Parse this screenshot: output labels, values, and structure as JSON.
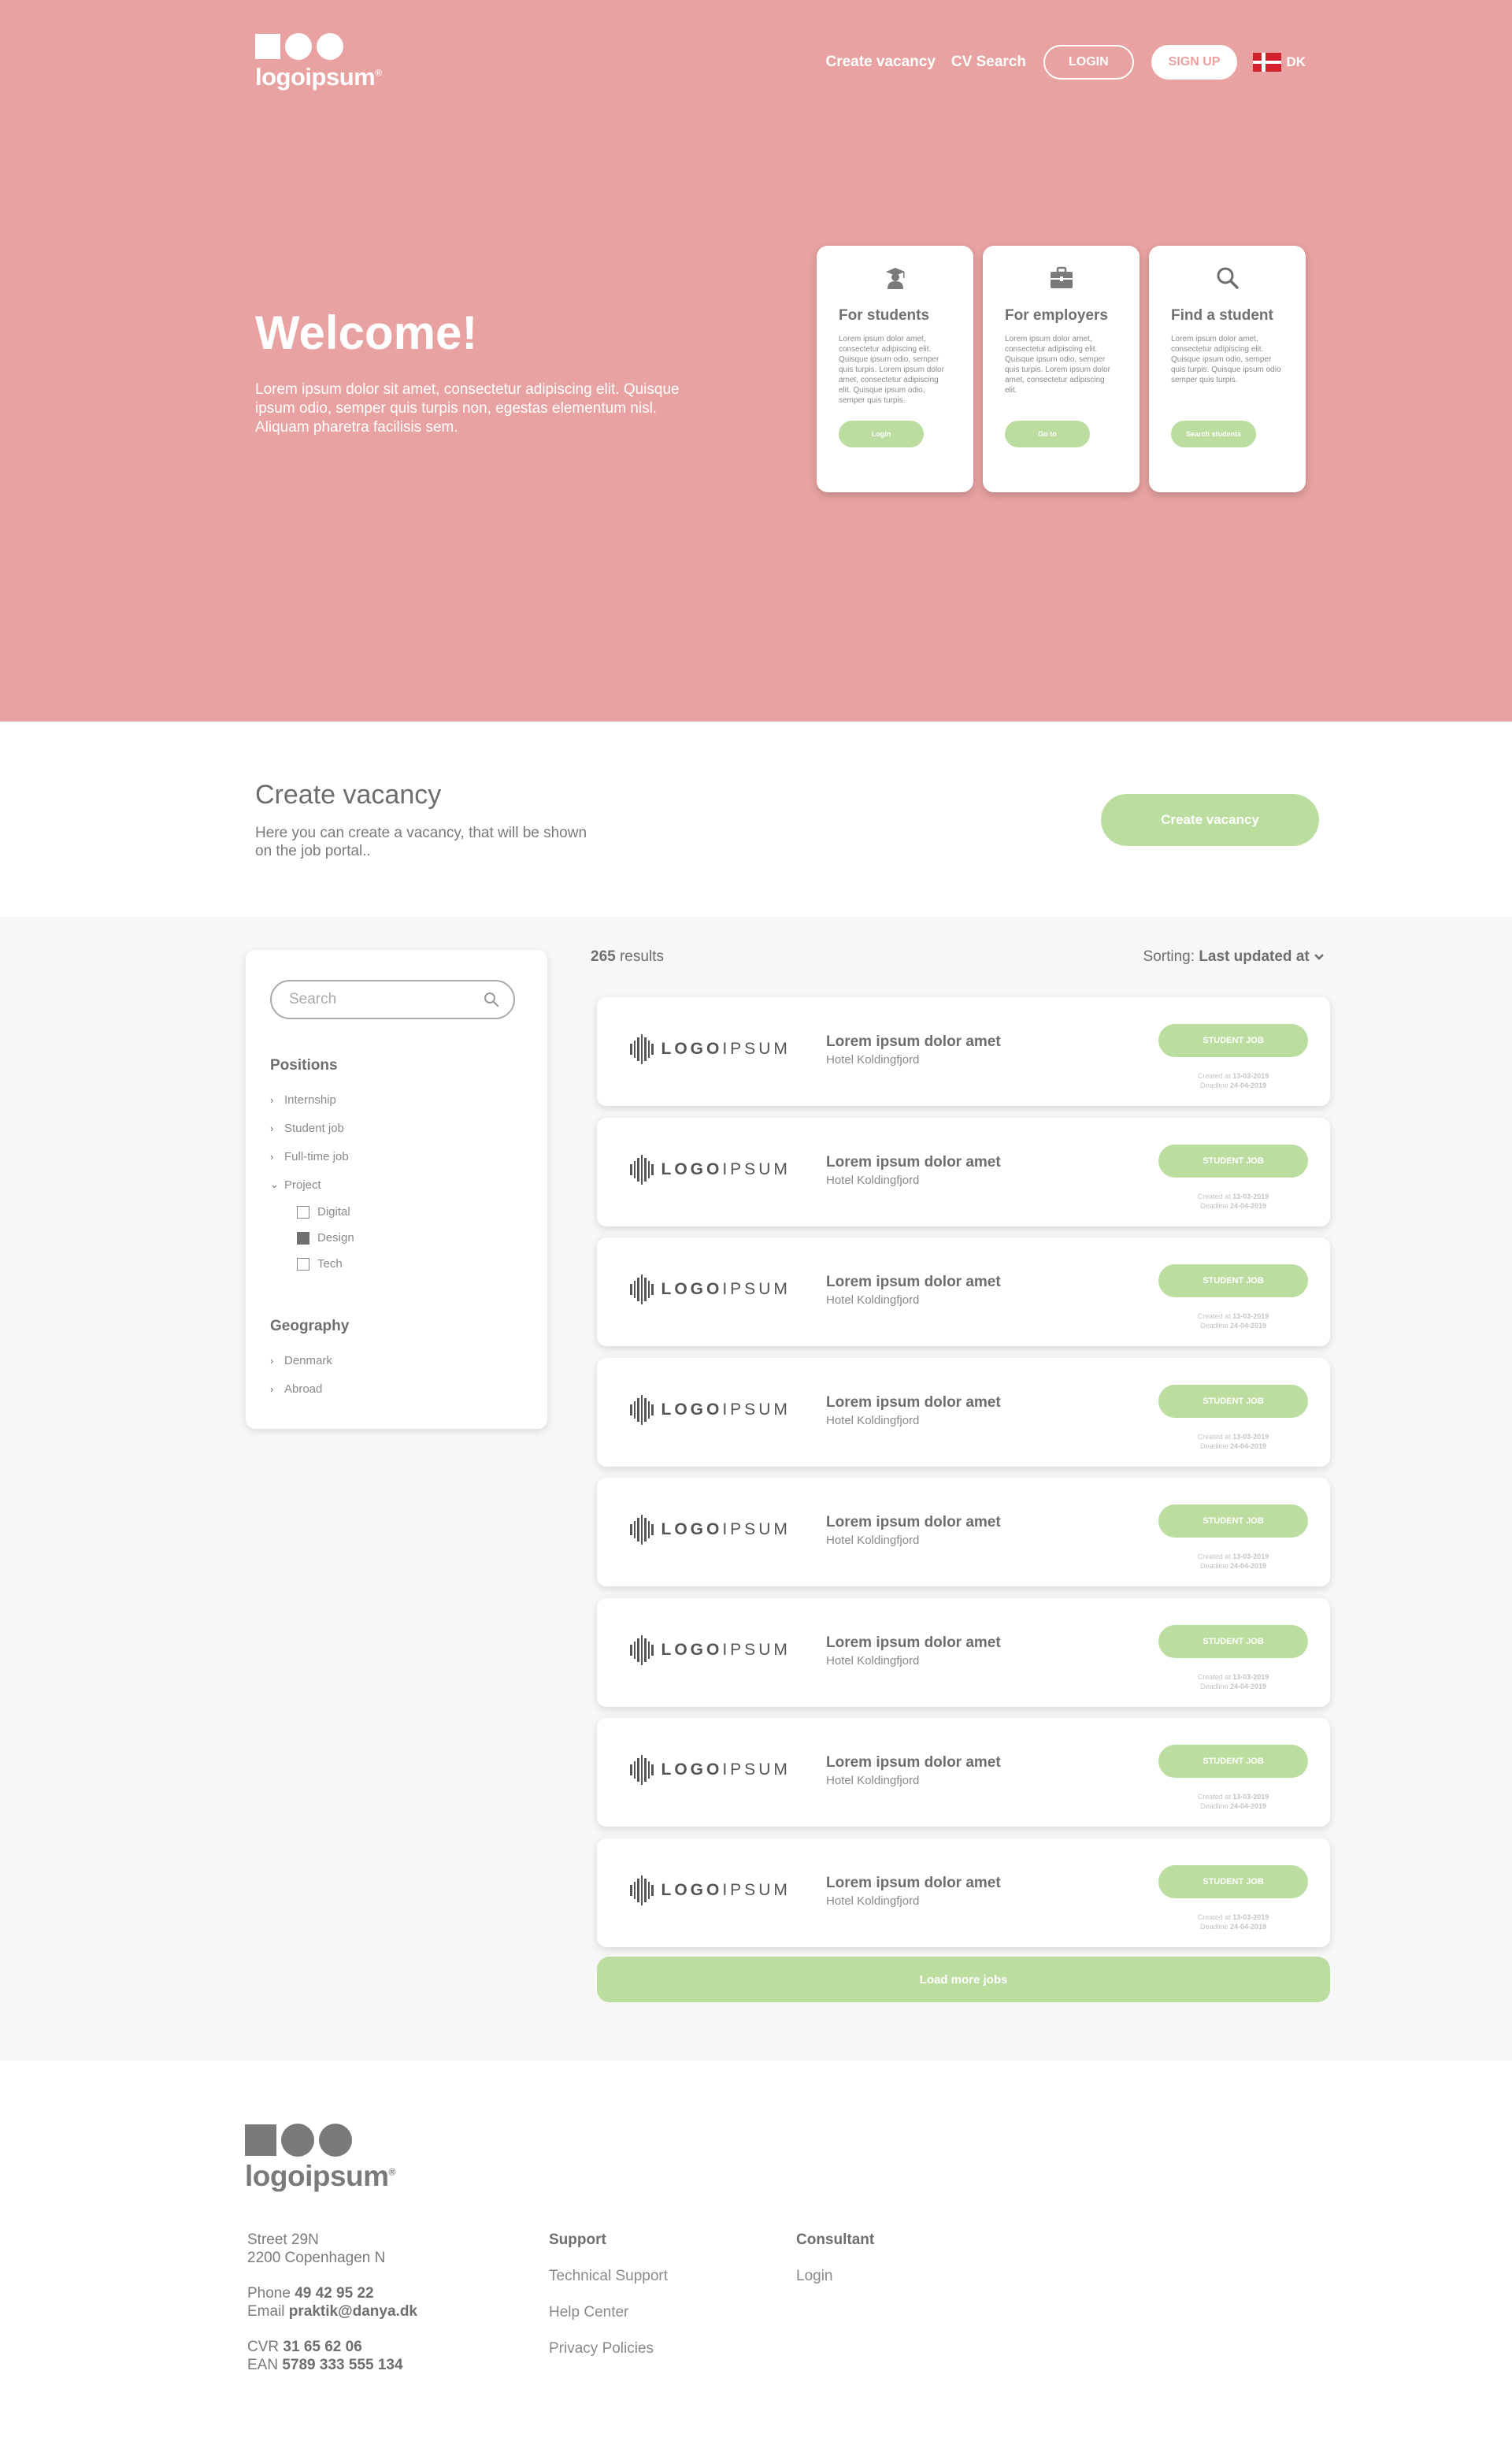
{
  "brand": {
    "name": "logoipsum",
    "mark": "®"
  },
  "nav": {
    "links": [
      "Create vacancy",
      "CV Search"
    ],
    "login": "LOGIN",
    "signup": "SIGN UP",
    "lang": "DK"
  },
  "hero": {
    "title": "Welcome!",
    "text": "Lorem ipsum dolor sit amet, consectetur adipiscing elit. Quisque ipsum odio, semper quis turpis non, egestas elementum nisl. Aliquam pharetra facilisis sem."
  },
  "cards": [
    {
      "icon": "graduate-icon",
      "title": "For students",
      "text": "Lorem ipsum dolor amet, consectetur adipiscing elit. Quisque ipsum odio, semper quis turpis. Lorem ipsum dolor amet, consectetur adipiscing elit. Quisque ipsum odio, semper quis turpis.",
      "button": "Login"
    },
    {
      "icon": "briefcase-icon",
      "title": "For employers",
      "text": "Lorem ipsum dolor amet, consectetur adipiscing elit. Quisque ipsum odio, semper quis turpis. Lorem ipsum dolor amet, consectetur adipiscing elit.",
      "button": "Go to"
    },
    {
      "icon": "search-icon",
      "title": "Find a student",
      "text": "Lorem ipsum dolor amet, consectetur adipiscing elit. Quisque ipsum odio, semper quis turpis. Quisque ipsum odio semper quis turpis.",
      "button": "Search students"
    }
  ],
  "create": {
    "title": "Create vacancy",
    "text": "Here you can create a vacancy, that will be shown on the job portal..",
    "button": "Create vacancy"
  },
  "filters": {
    "search_placeholder": "Search",
    "positions_title": "Positions",
    "positions": [
      {
        "label": "Internship",
        "chevron": "›"
      },
      {
        "label": "Student job",
        "chevron": "›"
      },
      {
        "label": "Full-time job",
        "chevron": "›"
      },
      {
        "label": "Project",
        "chevron": "⌄"
      }
    ],
    "project_options": [
      {
        "label": "Digital",
        "checked": false
      },
      {
        "label": "Design",
        "checked": true
      },
      {
        "label": "Tech",
        "checked": false
      }
    ],
    "geography_title": "Geography",
    "geography": [
      {
        "label": "Denmark",
        "chevron": "›"
      },
      {
        "label": "Abroad",
        "chevron": "›"
      }
    ]
  },
  "results": {
    "count": "265",
    "suffix": "results"
  },
  "sorting": {
    "label": "Sorting:",
    "value": "Last updated at"
  },
  "jobs": [
    {
      "logo_bold": "LOGO",
      "logo_light": "IPSUM",
      "title": "Lorem ipsum dolor amet",
      "company": "Hotel Koldingfjord",
      "tag": "STUDENT JOB",
      "created_label": "Created at",
      "created": "13-03-2019",
      "deadline_label": "Deadline",
      "deadline": "24-04-2019"
    },
    {
      "logo_bold": "LOGO",
      "logo_light": "IPSUM",
      "title": "Lorem ipsum dolor amet",
      "company": "Hotel Koldingfjord",
      "tag": "STUDENT JOB",
      "created_label": "Created at",
      "created": "13-03-2019",
      "deadline_label": "Deadline",
      "deadline": "24-04-2019"
    },
    {
      "logo_bold": "LOGO",
      "logo_light": "IPSUM",
      "title": "Lorem ipsum dolor amet",
      "company": "Hotel Koldingfjord",
      "tag": "STUDENT JOB",
      "created_label": "Created at",
      "created": "13-03-2019",
      "deadline_label": "Deadline",
      "deadline": "24-04-2019"
    },
    {
      "logo_bold": "LOGO",
      "logo_light": "IPSUM",
      "title": "Lorem ipsum dolor amet",
      "company": "Hotel Koldingfjord",
      "tag": "STUDENT JOB",
      "created_label": "Created at",
      "created": "13-03-2019",
      "deadline_label": "Deadline",
      "deadline": "24-04-2019"
    },
    {
      "logo_bold": "LOGO",
      "logo_light": "IPSUM",
      "title": "Lorem ipsum dolor amet",
      "company": "Hotel Koldingfjord",
      "tag": "STUDENT JOB",
      "created_label": "Created at",
      "created": "13-03-2019",
      "deadline_label": "Deadline",
      "deadline": "24-04-2019"
    },
    {
      "logo_bold": "LOGO",
      "logo_light": "IPSUM",
      "title": "Lorem ipsum dolor amet",
      "company": "Hotel Koldingfjord",
      "tag": "STUDENT JOB",
      "created_label": "Created at",
      "created": "13-03-2019",
      "deadline_label": "Deadline",
      "deadline": "24-04-2019"
    },
    {
      "logo_bold": "LOGO",
      "logo_light": "IPSUM",
      "title": "Lorem ipsum dolor amet",
      "company": "Hotel Koldingfjord",
      "tag": "STUDENT JOB",
      "created_label": "Created at",
      "created": "13-03-2019",
      "deadline_label": "Deadline",
      "deadline": "24-04-2019"
    },
    {
      "logo_bold": "LOGO",
      "logo_light": "IPSUM",
      "title": "Lorem ipsum dolor amet",
      "company": "Hotel Koldingfjord",
      "tag": "STUDENT JOB",
      "created_label": "Created at",
      "created": "13-03-2019",
      "deadline_label": "Deadline",
      "deadline": "24-04-2019"
    }
  ],
  "load_more": "Load more jobs",
  "footer": {
    "address_line1": "Street 29N",
    "address_line2": "2200 Copenhagen N",
    "phone_label": "Phone",
    "phone": "49 42 95 22",
    "email_label": "Email",
    "email": "praktik@danya.dk",
    "cvr_label": "CVR",
    "cvr": "31 65 62 06",
    "ean_label": "EAN",
    "ean": "5789 333 555 134",
    "support_title": "Support",
    "support_links": [
      "Technical Support",
      "Help Center",
      "Privacy Policies"
    ],
    "consultant_title": "Consultant",
    "consultant_links": [
      "Login"
    ]
  },
  "colors": {
    "hero_bg": "#e7a2a1",
    "accent_green": "#bbdea0",
    "listing_bg": "#f7f7f7",
    "text_gray": "#6e6e6e"
  }
}
